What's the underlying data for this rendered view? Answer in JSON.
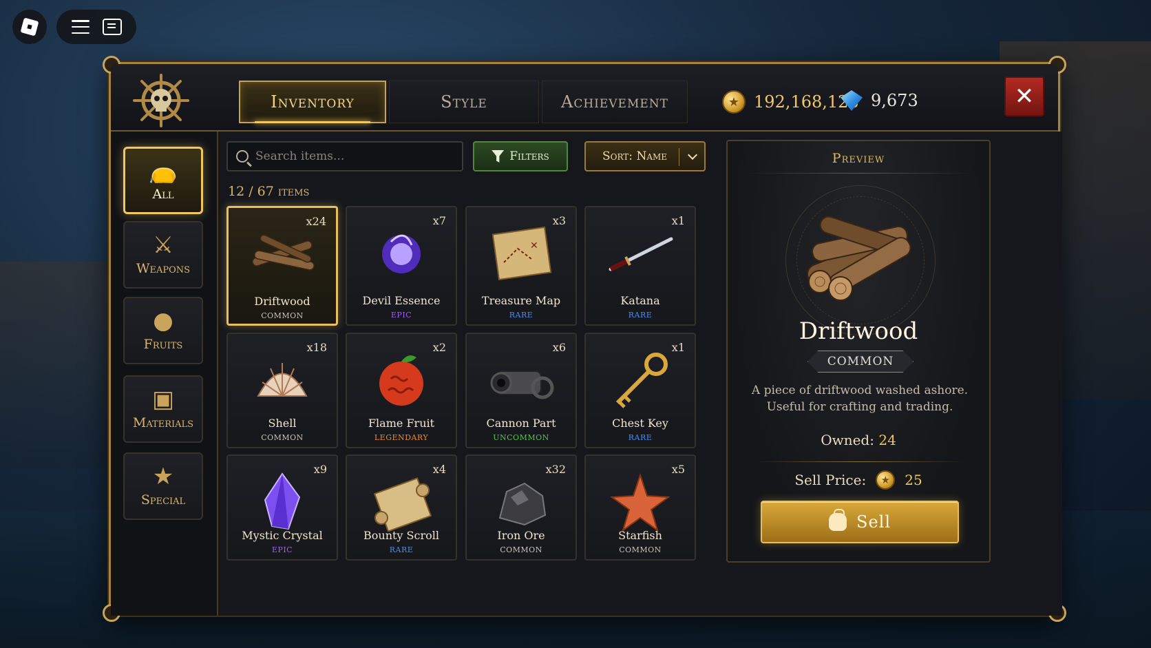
{
  "header": {
    "tabs": [
      {
        "label": "Inventory",
        "active": true
      },
      {
        "label": "Style",
        "active": false
      },
      {
        "label": "Achievement",
        "active": false
      }
    ],
    "coins": "192,168,123",
    "gems": "9,673",
    "close_label": "✕"
  },
  "sidebar": {
    "categories": [
      {
        "label": "All",
        "icon": "bag-icon",
        "active": true
      },
      {
        "label": "Weapons",
        "icon": "crossed-swords-icon",
        "active": false
      },
      {
        "label": "Fruits",
        "icon": "fruit-icon",
        "active": false
      },
      {
        "label": "Materials",
        "icon": "crate-icon",
        "active": false
      },
      {
        "label": "Special",
        "icon": "star-icon",
        "active": false
      }
    ]
  },
  "toolbar": {
    "search_placeholder": "Search items...",
    "filters_label": "Filters",
    "sort_label": "Sort: Name"
  },
  "item_count": "12 / 67 items",
  "items": [
    {
      "name": "Driftwood",
      "rarity": "COMMON",
      "qty": "x24",
      "icon": "driftwood-icon"
    },
    {
      "name": "Devil Essence",
      "rarity": "EPIC",
      "qty": "x7",
      "icon": "devil-essence-icon"
    },
    {
      "name": "Treasure Map",
      "rarity": "RARE",
      "qty": "x3",
      "icon": "treasure-map-icon"
    },
    {
      "name": "Katana",
      "rarity": "RARE",
      "qty": "x1",
      "icon": "katana-icon"
    },
    {
      "name": "Shell",
      "rarity": "COMMON",
      "qty": "x18",
      "icon": "shell-icon"
    },
    {
      "name": "Flame Fruit",
      "rarity": "LEGENDARY",
      "qty": "x2",
      "icon": "flame-fruit-icon"
    },
    {
      "name": "Cannon Part",
      "rarity": "UNCOMMON",
      "qty": "x6",
      "icon": "cannon-part-icon"
    },
    {
      "name": "Chest Key",
      "rarity": "RARE",
      "qty": "x1",
      "icon": "chest-key-icon"
    },
    {
      "name": "Mystic Crystal",
      "rarity": "EPIC",
      "qty": "x9",
      "icon": "mystic-crystal-icon"
    },
    {
      "name": "Bounty Scroll",
      "rarity": "RARE",
      "qty": "x4",
      "icon": "bounty-scroll-icon"
    },
    {
      "name": "Iron Ore",
      "rarity": "COMMON",
      "qty": "x32",
      "icon": "iron-ore-icon"
    },
    {
      "name": "Starfish",
      "rarity": "COMMON",
      "qty": "x5",
      "icon": "starfish-icon"
    }
  ],
  "rarity_colors": {
    "COMMON": "#c9c4b8",
    "UNCOMMON": "#4cc94a",
    "RARE": "#4a8df0",
    "EPIC": "#a35cf0",
    "LEGENDARY": "#f08a2a"
  },
  "preview": {
    "title": "Preview",
    "name": "Driftwood",
    "rarity": "COMMON",
    "description": "A piece of driftwood washed ashore. Useful for crafting and trading.",
    "owned_label": "Owned:",
    "owned_value": "24",
    "sell_price_label": "Sell Price:",
    "sell_price_value": "25",
    "sell_label": "Sell"
  }
}
